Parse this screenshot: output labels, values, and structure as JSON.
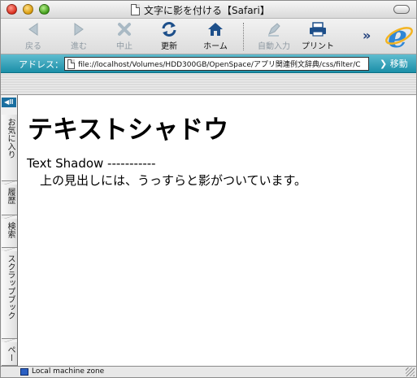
{
  "window": {
    "title": "文字に影を付ける【Safari】"
  },
  "toolbar": {
    "back_label": "戻る",
    "forward_label": "進む",
    "stop_label": "中止",
    "refresh_label": "更新",
    "home_label": "ホーム",
    "autofill_label": "自動入力",
    "print_label": "プリント",
    "overflow": "»"
  },
  "address_bar": {
    "label": "アドレス：",
    "url": "file://localhost/Volumes/HDD300GB/OpenSpace/アプリ関連例文辞典/css/filter/C",
    "go_label": "移動"
  },
  "explorer_bar": {
    "collapse_glyph": "◀Ⅲ",
    "tabs": [
      "お気に入り",
      "履歴",
      "検索",
      "スクラップブック",
      "ペー"
    ]
  },
  "page": {
    "heading": "テキストシャドウ",
    "line1": "Text Shadow -----------",
    "line2": "上の見出しには、うっすらと影がついています。"
  },
  "status_bar": {
    "zone": "Local machine zone"
  },
  "colors": {
    "address_bar": "#1b8fa8",
    "disabled_label": "#8f9aa3",
    "icon_blue": "#1d4f8a"
  },
  "icons": [
    "back-arrow-icon",
    "forward-arrow-icon",
    "stop-x-icon",
    "refresh-icon",
    "home-icon",
    "autofill-icon",
    "printer-icon",
    "ie-logo-icon",
    "document-icon"
  ]
}
